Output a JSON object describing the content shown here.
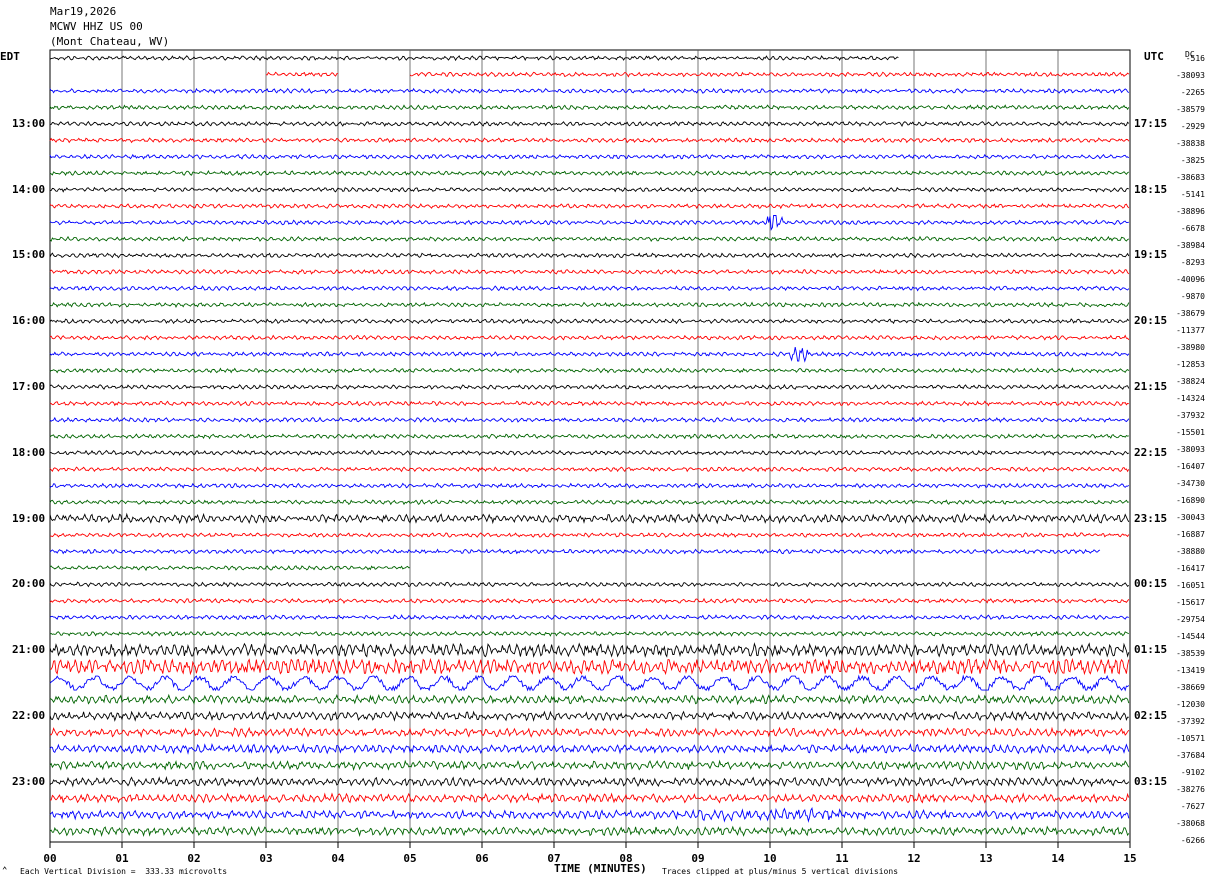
{
  "header": {
    "date": "Mar19,2026",
    "station": "MCWV HHZ US 00",
    "location": "(Mont Chateau, WV)"
  },
  "left_tz": "EDT",
  "right_tz": "UTC",
  "dc_label": "DC",
  "footer": {
    "xlabel": "TIME (MINUTES)",
    "scale": "Each Vertical Division =  333.33 microvolts",
    "clip": "Traces clipped at plus/minus 5 vertical divisions"
  },
  "chart_data": {
    "type": "line",
    "title": "",
    "xlabel": "TIME (MINUTES)",
    "ylabel": "",
    "xlim": [
      0,
      15
    ],
    "x_ticks": [
      "00",
      "01",
      "02",
      "03",
      "04",
      "05",
      "06",
      "07",
      "08",
      "09",
      "10",
      "11",
      "12",
      "13",
      "14",
      "15"
    ],
    "trace_colors": [
      "#000000",
      "#ff0000",
      "#0000ff",
      "#006400"
    ],
    "grid": true,
    "left_hour_labels": [
      "13:00",
      "14:00",
      "15:00",
      "16:00",
      "17:00",
      "18:00",
      "19:00",
      "20:00",
      "21:00",
      "22:00",
      "23:00"
    ],
    "right_hour_labels": [
      "17:15",
      "18:15",
      "19:15",
      "20:15",
      "21:15",
      "22:15",
      "23:15",
      "00:15",
      "01:15",
      "02:15",
      "03:15"
    ],
    "dc_offsets": [
      "-516",
      "-38093",
      "-2265",
      "-38579",
      "-2929",
      "-38838",
      "-3825",
      "-38683",
      "-5141",
      "-38896",
      "-6678",
      "-38984",
      "-8293",
      "-40096",
      "-9870",
      "-38679",
      "-11377",
      "-38980",
      "-12853",
      "-38824",
      "-14324",
      "-37932",
      "-15501",
      "-38093",
      "-16407",
      "-34730",
      "-16890",
      "-30043",
      "-16887",
      "-38880",
      "-16417",
      "-16051",
      "-15617",
      "-29754",
      "-14544",
      "-38539",
      "-13419",
      "-38669",
      "-12030",
      "-37392",
      "-10571",
      "-37684",
      "-9102",
      "-38276",
      "-7627",
      "-38068",
      "-6266"
    ],
    "trace_count": 48,
    "partial_traces": [
      {
        "trace": 0,
        "start_minute": 0,
        "end_minute": 11.8
      },
      {
        "trace": 1,
        "start_minute": 3,
        "end_minute": 4
      },
      {
        "trace": 1,
        "start_minute": 5,
        "end_minute": 15
      },
      {
        "trace": 30,
        "start_minute": 0,
        "end_minute": 14.6
      },
      {
        "trace": 31,
        "start_minute": 0,
        "end_minute": 5
      }
    ],
    "amplitude_by_trace": [
      1,
      1,
      1,
      1,
      1,
      1,
      1,
      1,
      1,
      1,
      1,
      1,
      1,
      1,
      1,
      1,
      1,
      1,
      1,
      1,
      1,
      1,
      1,
      1,
      1,
      1,
      1,
      1,
      2,
      1,
      1,
      1,
      1,
      1,
      1,
      1,
      1,
      2,
      4,
      2,
      2,
      2,
      2,
      2,
      2,
      2,
      2,
      2
    ],
    "events": [
      {
        "trace": 10,
        "minute": 10.05,
        "amplitude": 6
      },
      {
        "trace": 18,
        "minute": 10.4,
        "amplitude": 5
      },
      {
        "trace": 36,
        "minute": 0,
        "end_minute": 15,
        "amplitude": 3
      },
      {
        "trace": 37,
        "minute": 0,
        "end_minute": 15,
        "amplitude": 4
      },
      {
        "trace": 46,
        "minute": 9,
        "end_minute": 11,
        "amplitude": 3
      }
    ]
  }
}
